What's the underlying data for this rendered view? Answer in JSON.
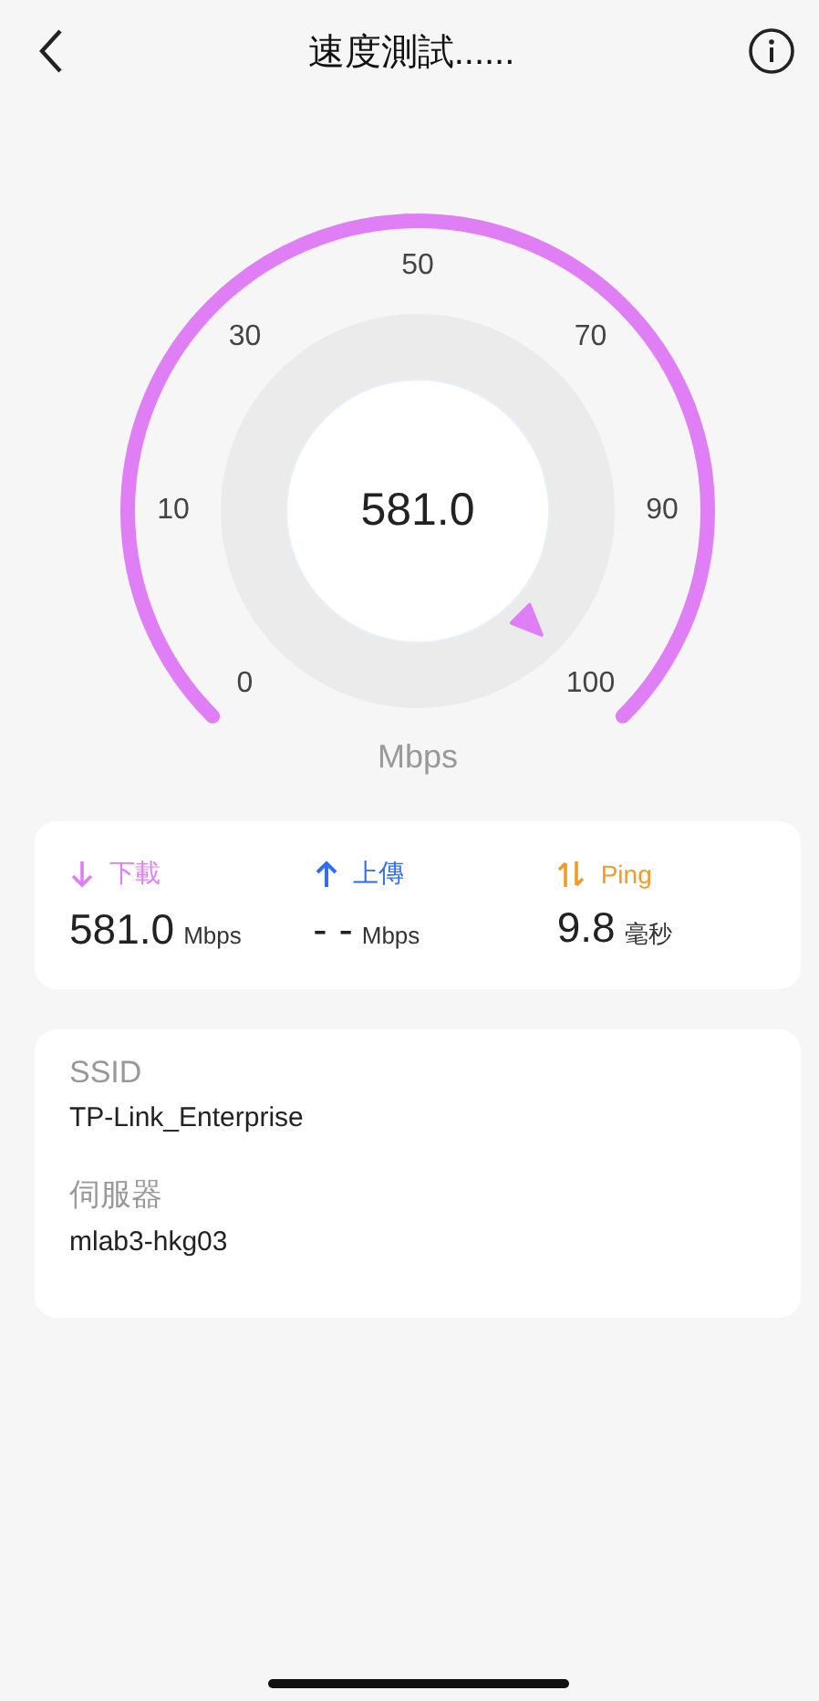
{
  "header": {
    "title": "速度測試......"
  },
  "gauge": {
    "reading": "581.0",
    "unit": "Mbps",
    "ticks": [
      "0",
      "10",
      "30",
      "50",
      "70",
      "90",
      "100"
    ]
  },
  "stats": [
    {
      "kind": "download",
      "label": "下載",
      "value": "581.0",
      "unit": "Mbps",
      "color": "#e07ef5"
    },
    {
      "kind": "upload",
      "label": "上傳",
      "value": "- -",
      "unit": "Mbps",
      "color": "#2f6ef5"
    },
    {
      "kind": "ping",
      "label": "Ping",
      "value": "9.8",
      "unit": "毫秒",
      "color": "#f59a23"
    }
  ],
  "info": [
    {
      "label": "SSID",
      "value": "TP-Link_Enterprise"
    },
    {
      "label": "伺服器",
      "value": "mlab3-hkg03"
    }
  ]
}
